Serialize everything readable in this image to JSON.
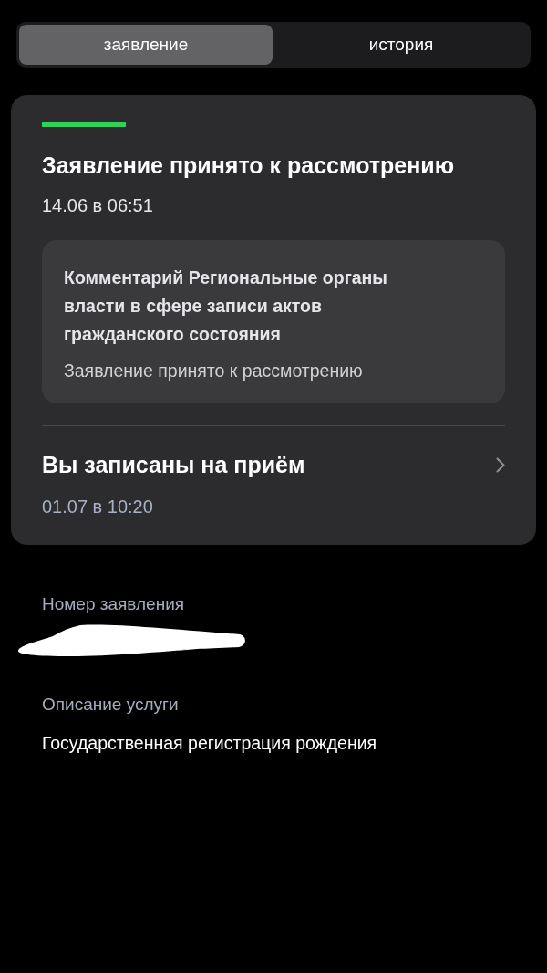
{
  "tabs": [
    {
      "label": "заявление",
      "selected": true
    },
    {
      "label": "история",
      "selected": false
    }
  ],
  "status": {
    "title": "Заявление принято к рассмотрению",
    "date": "14.06 в 06:51",
    "comment": {
      "title": "Комментарий Региональные органы власти в сфере записи актов гражданского состояния",
      "text": "Заявление принято к рассмотрению"
    }
  },
  "appointment": {
    "title": "Вы записаны на приём",
    "date": "01.07 в 10:20"
  },
  "details": [
    {
      "label": "Номер заявления",
      "kind": "redacted"
    },
    {
      "label": "Описание услуги",
      "value": "Государственная регистрация рождения",
      "kind": "text"
    }
  ]
}
